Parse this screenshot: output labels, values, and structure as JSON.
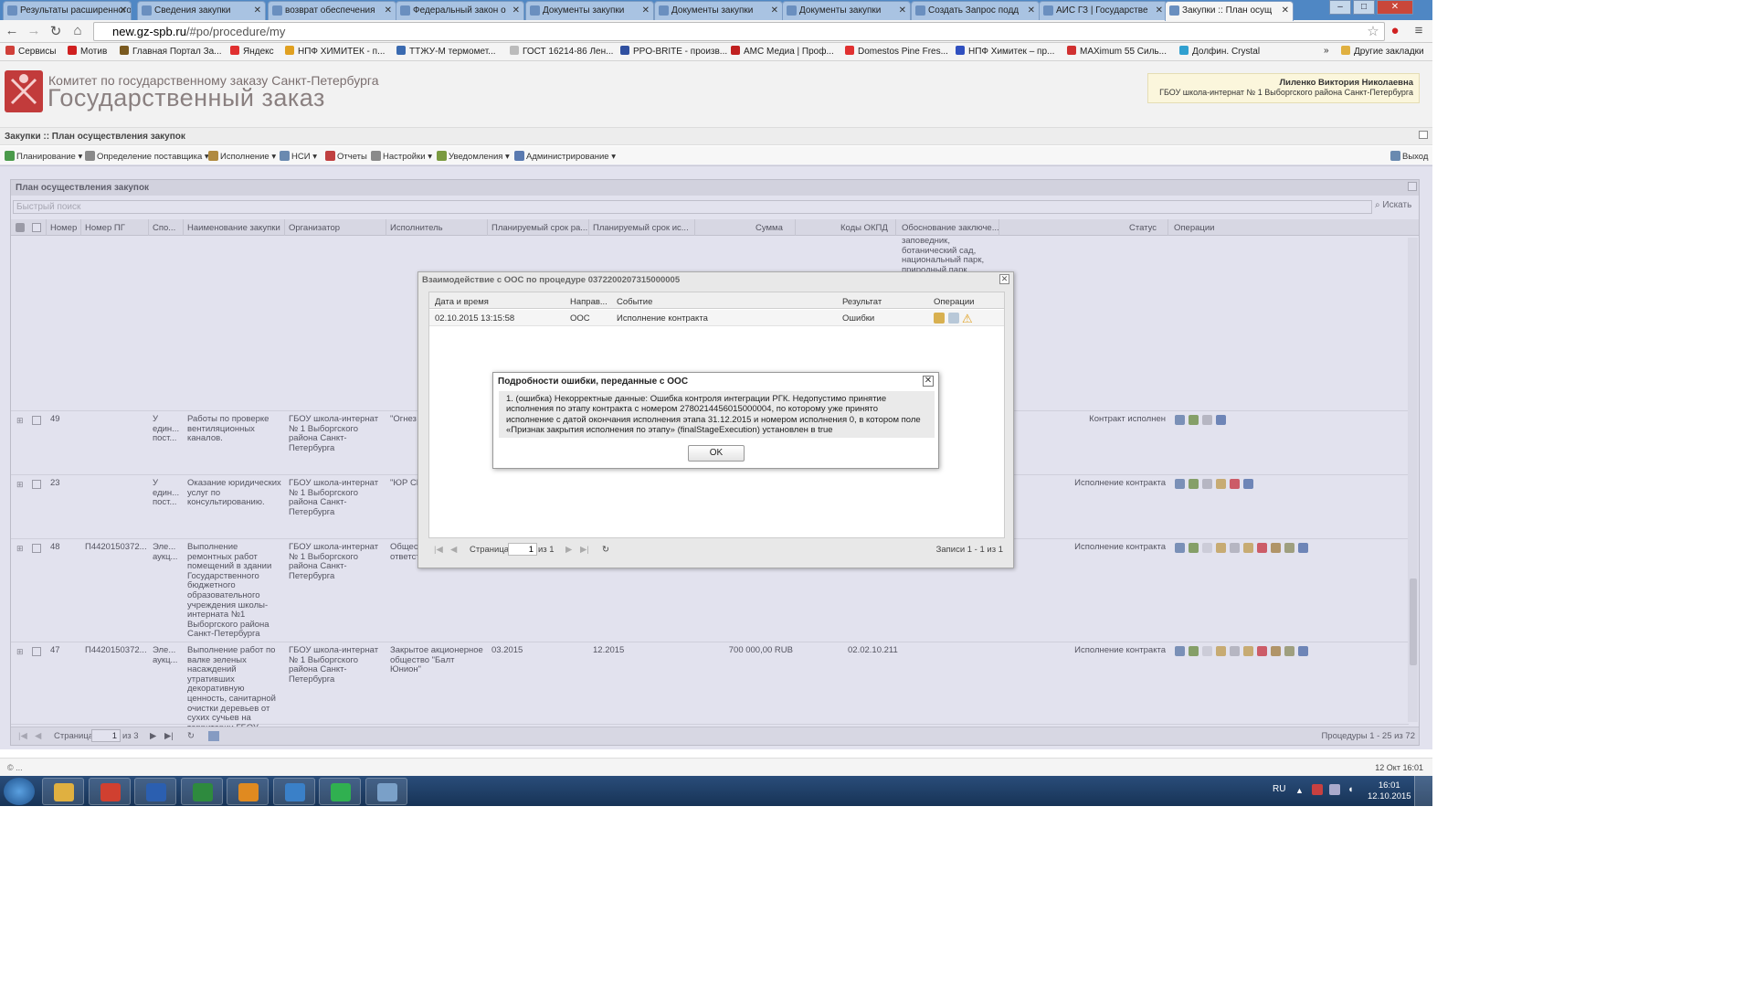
{
  "browser": {
    "tabs": [
      {
        "label": "Результаты расширенного"
      },
      {
        "label": "Сведения закупки"
      },
      {
        "label": "возврат обеспечения"
      },
      {
        "label": "Федеральный закон о"
      },
      {
        "label": "Документы закупки"
      },
      {
        "label": "Документы закупки"
      },
      {
        "label": "Документы закупки"
      },
      {
        "label": "Создать Запрос подд"
      },
      {
        "label": "АИС ГЗ | Государстве"
      },
      {
        "label": "Закупки :: План осущ"
      }
    ],
    "url_host": "new.gz-spb.ru",
    "url_path": "/#po/procedure/my",
    "bookmarks": [
      {
        "label": "Сервисы",
        "color": "#d0403a"
      },
      {
        "label": "Мотив",
        "color": "#d02020"
      },
      {
        "label": "Главная Портал За...",
        "color": "#7a5a20"
      },
      {
        "label": "Яндекс",
        "color": "#e03030"
      },
      {
        "label": "НПФ ХИМИТЕК - п...",
        "color": "#e0a020"
      },
      {
        "label": "ТТЖУ-М термомет...",
        "color": "#3a6ab0"
      },
      {
        "label": "ГОСТ 16214-86 Лен...",
        "color": "#bbbbbb"
      },
      {
        "label": "PPO-BRITE - произв...",
        "color": "#3050a0"
      },
      {
        "label": "АМС Медиа | Проф...",
        "color": "#c02020"
      },
      {
        "label": "Domestos Pine Fres...",
        "color": "#e03030"
      },
      {
        "label": "НПФ Химитек – пр...",
        "color": "#3050c0"
      },
      {
        "label": "MAXimum 55 Силь...",
        "color": "#d03030"
      },
      {
        "label": "Долфин. Crystal",
        "color": "#30a0d0"
      },
      {
        "label": "Другие закладки",
        "color": "#e0b040"
      }
    ],
    "more_chevron": "»"
  },
  "header": {
    "org": "Комитет по государственному заказу Санкт-Петербурга",
    "app": "Государственный заказ",
    "user_name": "Лиленко Виктория Николаевна",
    "user_org": "ГБОУ школа-интернат № 1 Выборгского района Санкт-Петербурга"
  },
  "breadcrumb": "Закупки :: План осуществления закупок",
  "menu": {
    "items": [
      {
        "label": "Планирование ▾",
        "color": "#4a9a4a"
      },
      {
        "label": "Определение поставщика ▾",
        "color": "#8a8a8a"
      },
      {
        "label": "Исполнение ▾",
        "color": "#b08a40"
      },
      {
        "label": "НСИ ▾",
        "color": "#6a8ab0"
      },
      {
        "label": "Отчеты",
        "color": "#c04040"
      },
      {
        "label": "Настройки ▾",
        "color": "#8a8a8a"
      },
      {
        "label": "Уведомления ▾",
        "color": "#7a9a40"
      },
      {
        "label": "Администрирование ▾",
        "color": "#5a7ab0"
      }
    ],
    "exit": "Выход"
  },
  "panel": {
    "title": "План осуществления закупок",
    "search_placeholder": "Быстрый поиск",
    "search_button": "Искать",
    "columns": [
      "Номер",
      "Номер ПГ",
      "Спо...",
      "Наименование закупки",
      "Организатор",
      "Исполнитель",
      "Планируемый срок ра...",
      "Планируемый срок ис...",
      "Сумма",
      "Коды ОКПД",
      "Обоснование заключе...",
      "Статус",
      "Операции"
    ],
    "top_fragment": "заповедник, ботанический сад, национальный парк, природный парк,",
    "rows": [
      {
        "num": "49",
        "pg": "",
        "method": "У един... пост...",
        "name": "Работы по проверке вентиляционных каналов.",
        "org": "ГБОУ школа-интернат № 1 Выборгского района Санкт-Петербурга",
        "exec": "\"Огнез",
        "start": "",
        "end": "",
        "sum": "",
        "okpd": "",
        "status": "Контракт исполнен"
      },
      {
        "num": "23",
        "pg": "",
        "method": "У един... пост...",
        "name": "Оказание юридических услуг по консультированию.",
        "org": "ГБОУ школа-интернат № 1 Выборгского района Санкт-Петербурга",
        "exec": "\"ЮР СЕ",
        "start": "",
        "end": "",
        "sum": "",
        "okpd": "",
        "status": "Исполнение контракта"
      },
      {
        "num": "48",
        "pg": "П4420150372...",
        "method": "Эле... аукц...",
        "name": "Выполнение ремонтных работ помещений в здании Государственного бюджетного образовательного учреждения школы-интерната №1 Выборгского района Санкт-Петербурга",
        "org": "ГБОУ школа-интернат № 1 Выборгского района Санкт-Петербурга",
        "exec": "Общест... ограни... ответст... Бастион\"",
        "start": "",
        "end": "",
        "sum": "",
        "okpd": "",
        "status": "Исполнение контракта"
      },
      {
        "num": "47",
        "pg": "П4420150372...",
        "method": "Эле... аукц...",
        "name": "Выполнение работ по валке зеленых насаждений утративших декоративную ценность, санитарной очистки деревьев от сухих сучьев на территории ГБОУ школы-интерната",
        "org": "ГБОУ школа-интернат № 1 Выборгского района Санкт-Петербурга",
        "exec": "Закрытое акционерное общество \"Балт Юнион\"",
        "start": "03.2015",
        "end": "12.2015",
        "sum": "700 000,00 RUB",
        "okpd": "02.02.10.211",
        "status": "Исполнение контракта"
      }
    ],
    "pager": {
      "page_label": "Страница",
      "page": "1",
      "of": "из 3",
      "records": "Процедуры 1 - 25 из 72"
    }
  },
  "dialog_oos": {
    "title": "Взаимодействие с ООС по процедуре 0372200207315000005",
    "columns": [
      "Дата и время",
      "Направ...",
      "Событие",
      "Результат",
      "Операции"
    ],
    "rows": [
      {
        "datetime": "02.10.2015 13:15:58",
        "direction": "ООС",
        "event": "Исполнение контракта",
        "result": "Ошибки"
      }
    ],
    "pager": {
      "page_label": "Страница",
      "page": "1",
      "of": "из 1",
      "records": "Записи 1 - 1 из 1"
    }
  },
  "dialog_error": {
    "title": "Подробности ошибки, переданные с ООС",
    "message": "1. (ошибка) Некорректные данные: Ошибка контроля интеграции РГК. Недопустимо принятие исполнения по этапу контракта с номером 2780214456015000004, по которому уже принято исполнение с датой окончания исполнения этапа 31.12.2015 и номером исполнения 0, в котором поле «Признак закрытия исполнения по этапу» (finalStageExecution) установлен в true",
    "ok": "OK"
  },
  "statusbar": {
    "left": "© ...",
    "right": "12 Окт 16:01"
  },
  "taskbar": {
    "lang": "RU",
    "time": "16:01",
    "date": "12.10.2015",
    "apps": [
      {
        "name": "explorer",
        "color": "#e0b040"
      },
      {
        "name": "chrome",
        "color": "#d04030"
      },
      {
        "name": "word",
        "color": "#2b5fb0"
      },
      {
        "name": "excel",
        "color": "#2e8a3e"
      },
      {
        "name": "outlook",
        "color": "#e08a20"
      },
      {
        "name": "lync",
        "color": "#3a80c8"
      },
      {
        "name": "agent",
        "color": "#30b050"
      },
      {
        "name": "window",
        "color": "#7aa0c8"
      }
    ]
  }
}
